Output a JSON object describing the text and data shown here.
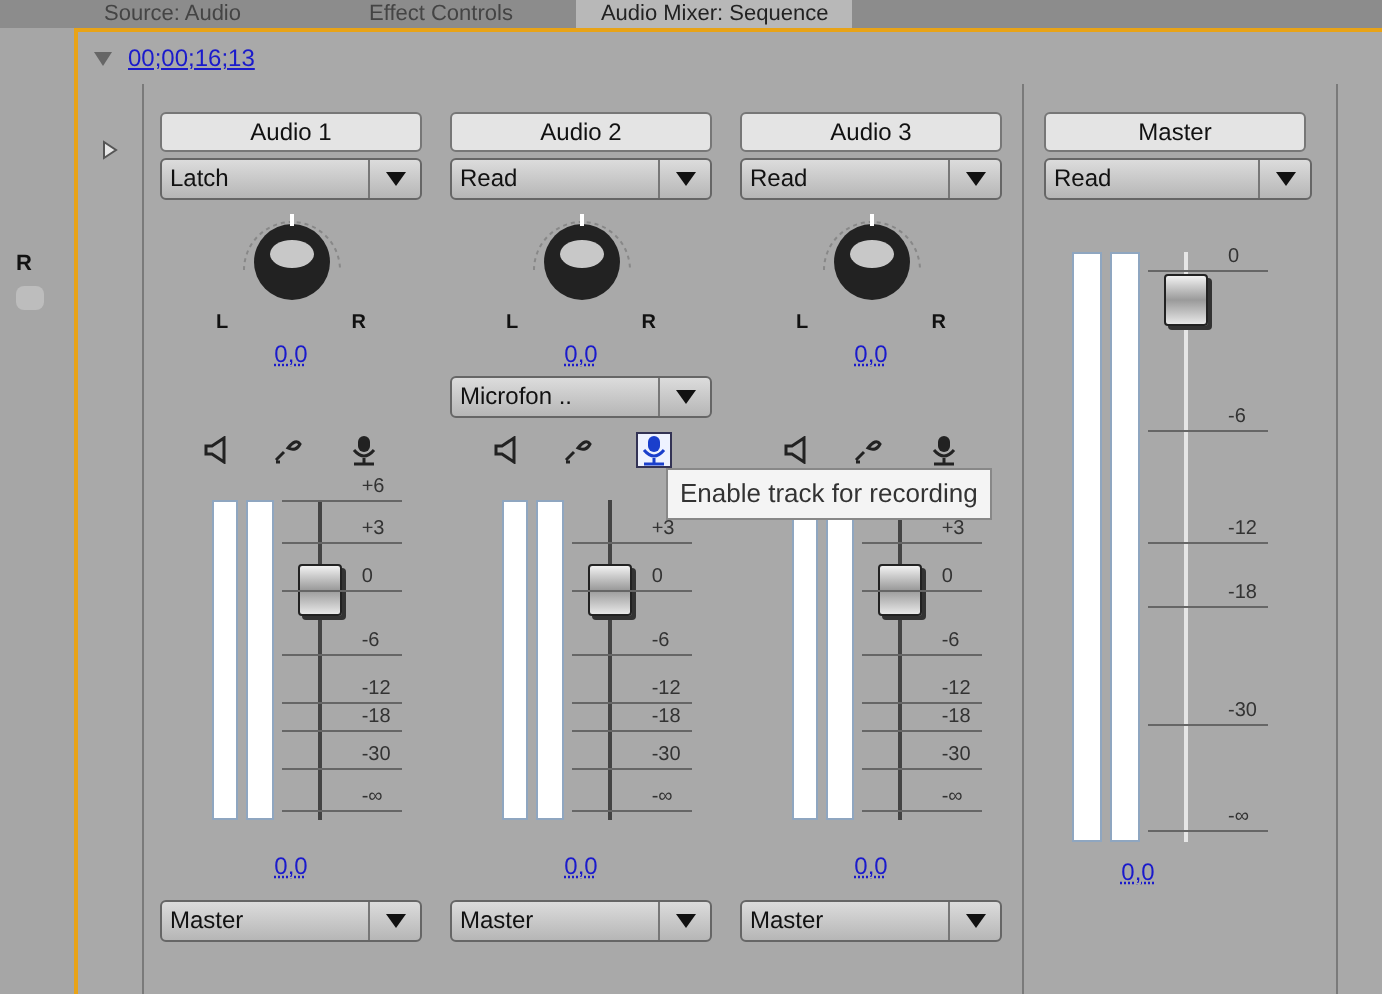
{
  "tabs": [
    {
      "label": "Source: Audio",
      "selected": false
    },
    {
      "label": "Effect Controls",
      "selected": false
    },
    {
      "label": "Audio Mixer: Sequence",
      "selected": true
    }
  ],
  "side_fragment": "R",
  "timecode": "00;00;16;13",
  "channels": [
    {
      "kind": "track",
      "name": "Audio 1",
      "mode": "Latch",
      "pan": "0,0",
      "pan_left": "L",
      "pan_right": "R",
      "record_enabled": false,
      "fader": {
        "level": 0.72
      },
      "scale": [
        "+6",
        "+3",
        "0",
        "-6",
        "-12",
        "-18",
        "-30",
        "-∞"
      ],
      "volume": "0,0",
      "output": "Master"
    },
    {
      "kind": "track",
      "name": "Audio 2",
      "mode": "Read",
      "pan": "0,0",
      "pan_left": "L",
      "pan_right": "R",
      "input": "Microfon ..",
      "record_enabled": true,
      "fader": {
        "level": 0.72
      },
      "scale": [
        "+3",
        "0",
        "-6",
        "-12",
        "-18",
        "-30",
        "-∞"
      ],
      "volume": "0,0",
      "output": "Master"
    },
    {
      "kind": "track",
      "name": "Audio 3",
      "mode": "Read",
      "pan": "0,0",
      "pan_left": "L",
      "pan_right": "R",
      "record_enabled": false,
      "fader": {
        "level": 0.72
      },
      "scale": [
        "+3",
        "0",
        "-6",
        "-12",
        "-18",
        "-30",
        "-∞"
      ],
      "volume": "0,0",
      "output": "Master"
    },
    {
      "kind": "master",
      "name": "Master",
      "mode": "Read",
      "fader": {
        "level": 0.92
      },
      "scale": [
        "0",
        "-6",
        "-12",
        "-18",
        "-30",
        "-∞"
      ],
      "volume": "0,0"
    }
  ],
  "tooltip": "Enable track for recording"
}
